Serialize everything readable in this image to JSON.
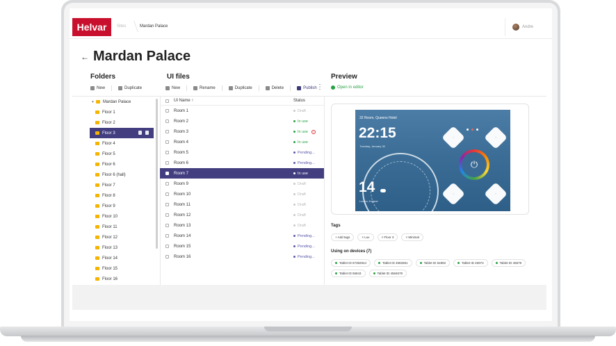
{
  "header": {
    "logo": "Helvar",
    "breadcrumb": [
      "Sites",
      "Mardan Palace"
    ],
    "user_name": "Andre"
  },
  "page": {
    "title": "Mardan Palace",
    "back_icon": "arrow-left-icon"
  },
  "folders": {
    "title": "Folders",
    "toolbar": {
      "new": "New",
      "duplicate": "Duplicate"
    },
    "root": "Mardan Palace",
    "items": [
      "Floor 1",
      "Floor 2",
      "Floor 3",
      "Floor 4",
      "Floor 5",
      "Floor 6",
      "Floor 6 (hall)",
      "Floor 7",
      "Floor 8",
      "Floor 9",
      "Floor 10",
      "Floor 11",
      "Floor 12",
      "Floor 13",
      "Floor 14",
      "Floor 15",
      "Floor 16"
    ],
    "selected": "Floor 3"
  },
  "ui_files": {
    "title": "UI files",
    "toolbar": {
      "new": "New",
      "rename": "Rename",
      "duplicate": "Duplicate",
      "delete": "Delete",
      "publish": "Publish"
    },
    "columns": {
      "name": "UI Name",
      "sort": "↑",
      "status": "Status"
    },
    "rows": [
      {
        "name": "Room 1",
        "status": "Draft",
        "color": "#c9c9c9"
      },
      {
        "name": "Room 2",
        "status": "In use",
        "color": "#27a243"
      },
      {
        "name": "Room 3",
        "status": "In use",
        "color": "#27a243",
        "warning": true
      },
      {
        "name": "Room 4",
        "status": "In use",
        "color": "#27a243"
      },
      {
        "name": "Room 5",
        "status": "Pending...",
        "color": "#5a57a8"
      },
      {
        "name": "Room 6",
        "status": "Pending...",
        "color": "#5a57a8"
      },
      {
        "name": "Room 7",
        "status": "In use",
        "color": "#ffffff",
        "selected": true
      },
      {
        "name": "Room 9",
        "status": "Draft",
        "color": "#c9c9c9"
      },
      {
        "name": "Room 10",
        "status": "Draft",
        "color": "#c9c9c9"
      },
      {
        "name": "Room 11",
        "status": "Draft",
        "color": "#c9c9c9"
      },
      {
        "name": "Room 12",
        "status": "Draft",
        "color": "#c9c9c9"
      },
      {
        "name": "Room 13",
        "status": "Draft",
        "color": "#c9c9c9"
      },
      {
        "name": "Room 14",
        "status": "Pending...",
        "color": "#5a57a8"
      },
      {
        "name": "Room 15",
        "status": "Pending...",
        "color": "#5a57a8"
      },
      {
        "name": "Room 16",
        "status": "Pending...",
        "color": "#5a57a8"
      }
    ]
  },
  "preview": {
    "title": "Preview",
    "open_editor": "Open in editor",
    "tablet": {
      "room": "32 Room, Queens Hotel",
      "time": "22:15",
      "date": "Tuesday, January 30",
      "temp": "14",
      "location": "London, England"
    },
    "tags_label": "Tags",
    "tags": [
      "+ Add tags",
      "× Lux",
      "× Floor 3",
      "× Minimal"
    ],
    "devices_label": "Using on devices (7)",
    "devices": [
      "Tablet ID 67382944",
      "Tablet ID 4582681",
      "Tablet ID 54892",
      "Tablet ID 45973",
      "Tablet ID 45678",
      "Tablet ID 56843",
      "Tablet ID 4584678"
    ]
  },
  "colors": {
    "brand": "#c8102e",
    "selection": "#423e80",
    "in_use": "#27a243",
    "pending": "#5a57a8",
    "draft": "#c9c9c9"
  }
}
